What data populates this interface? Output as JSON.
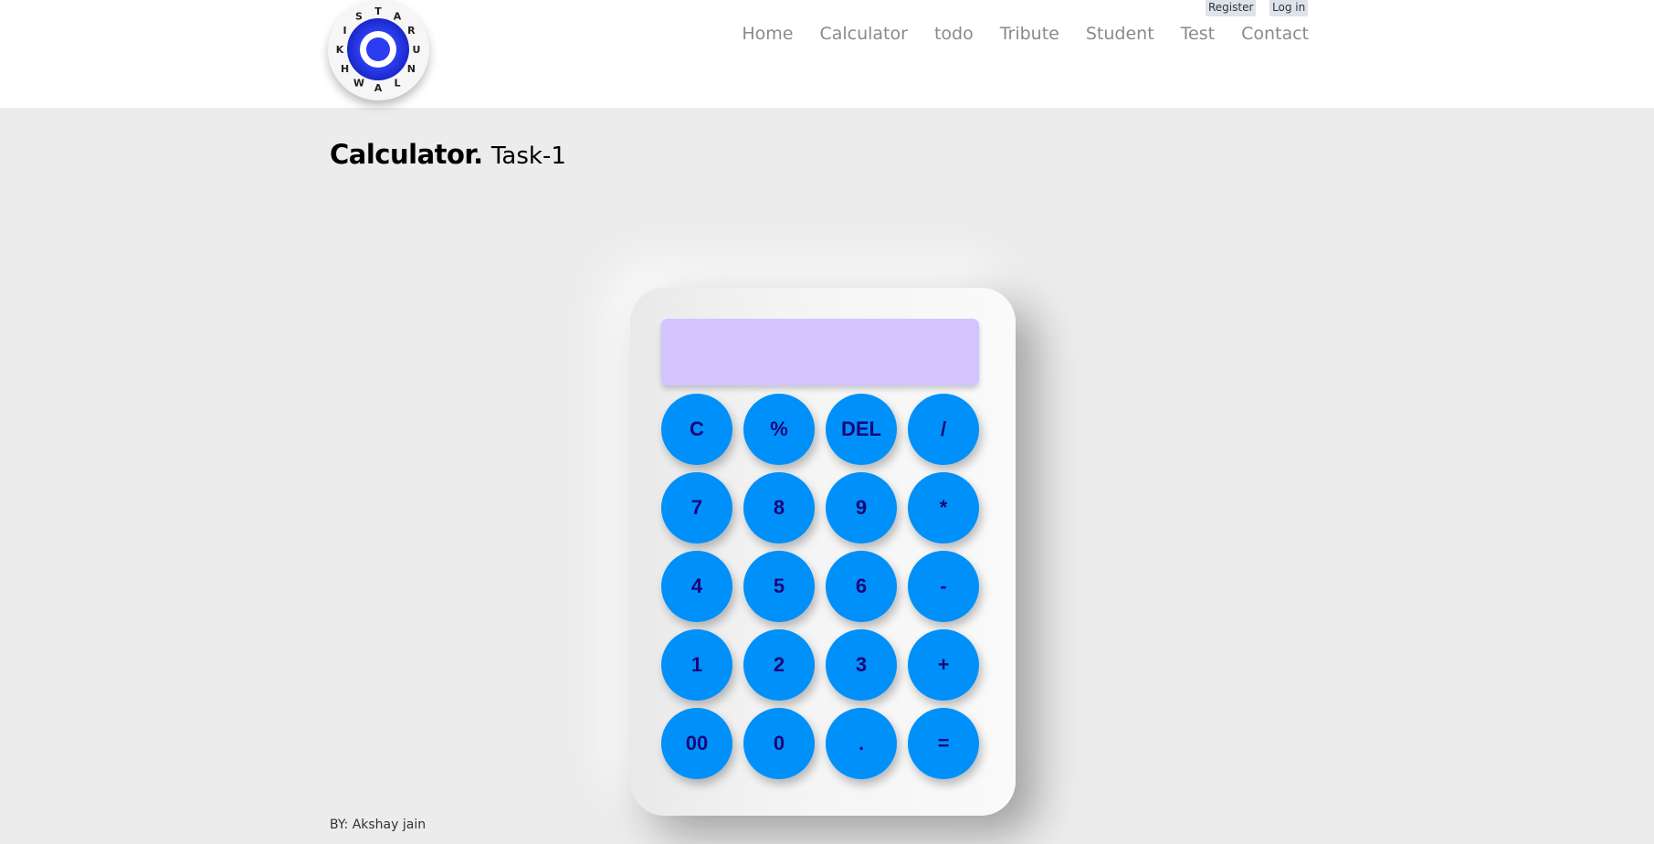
{
  "header": {
    "logo_letters": [
      "T",
      "A",
      "R",
      "U",
      "N",
      "L",
      "A",
      "W",
      "H",
      "K",
      "I",
      "S"
    ],
    "auth": {
      "register": "Register",
      "login": "Log in"
    },
    "nav": [
      "Home",
      "Calculator",
      "todo",
      "Tribute",
      "Student",
      "Test",
      "Contact"
    ]
  },
  "page": {
    "title": "Calculator.",
    "subtitle": "Task-1"
  },
  "calculator": {
    "display_value": "",
    "keys": [
      "C",
      "%",
      "DEL",
      "/",
      "7",
      "8",
      "9",
      "*",
      "4",
      "5",
      "6",
      "-",
      "1",
      "2",
      "3",
      "+",
      "00",
      "0",
      ".",
      "="
    ]
  },
  "footer": {
    "text": "BY: Akshay jain"
  },
  "colors": {
    "key": "#0090fa",
    "key_text": "#1b067a",
    "display": "#d3c3fe",
    "background": "#ececec"
  }
}
